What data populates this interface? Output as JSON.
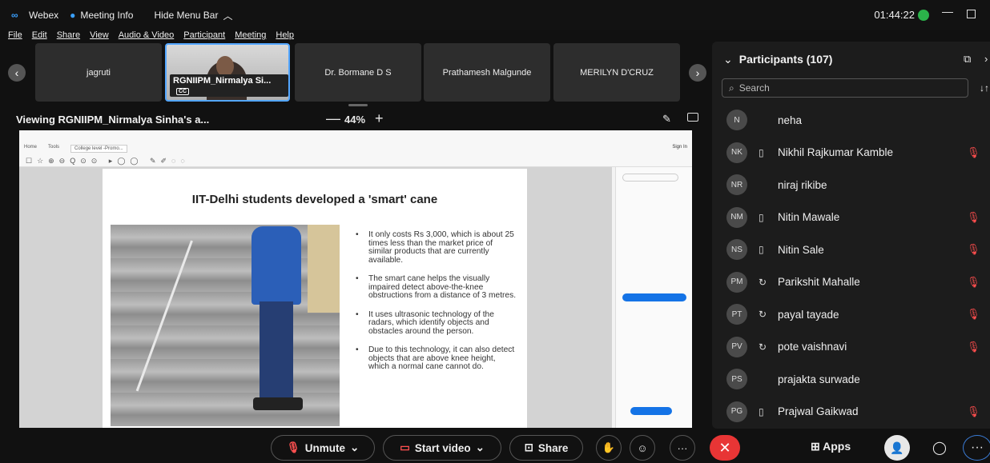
{
  "titlebar": {
    "app": "Webex",
    "meeting_info": "Meeting Info",
    "hide_menu": "Hide Menu Bar",
    "clock": "01:44:22"
  },
  "menu": [
    "File",
    "Edit",
    "Share",
    "View",
    "Audio & Video",
    "Participant",
    "Meeting",
    "Help"
  ],
  "strip": {
    "tiles": [
      "jagruti",
      "Dr. Bormane D S",
      "Prathamesh Malgunde",
      "MERILYN D'CRUZ"
    ],
    "active_name": "RGNIIPM_Nirmalya Si...",
    "cc": "CC"
  },
  "viewing": {
    "title": "Viewing RGNIIPM_Nirmalya Sinha's a...",
    "zoom": "44%"
  },
  "slide": {
    "title": "IIT-Delhi students developed a 'smart' cane",
    "bullets": [
      "It only costs Rs 3,000, which is about 25 times less than the market price of similar products that are currently available.",
      "The smart cane helps the visually impaired detect above-the-knee obstructions from a distance of 3 metres.",
      "It uses ultrasonic technology of the radars, which identify objects and obstacles around the person.",
      "Due to this technology, it can also detect objects that are above knee height, which a normal cane cannot do."
    ]
  },
  "acrobat": {
    "tabs": [
      "Home",
      "Tools",
      "College level -Promo..."
    ],
    "sign_in": "Sign In"
  },
  "panel": {
    "title": "Participants (107)",
    "search_placeholder": "Search",
    "participants": [
      {
        "initials": "N",
        "name": "neha",
        "icon": "",
        "muted": false
      },
      {
        "initials": "NK",
        "name": "Nikhil Rajkumar Kamble",
        "icon": "device-icon",
        "muted": true
      },
      {
        "initials": "NR",
        "name": "niraj rikibe",
        "icon": "",
        "muted": false
      },
      {
        "initials": "NM",
        "name": "Nitin Mawale",
        "icon": "device-icon",
        "muted": true
      },
      {
        "initials": "NS",
        "name": "Nitin Sale",
        "icon": "device-icon",
        "muted": true
      },
      {
        "initials": "PM",
        "name": "Parikshit Mahalle",
        "icon": "sync-icon",
        "muted": true
      },
      {
        "initials": "PT",
        "name": "payal tayade",
        "icon": "sync-icon",
        "muted": true
      },
      {
        "initials": "PV",
        "name": "pote vaishnavi",
        "icon": "sync-icon",
        "muted": true
      },
      {
        "initials": "PS",
        "name": "prajakta surwade",
        "icon": "",
        "muted": false
      },
      {
        "initials": "PG",
        "name": "Prajwal Gaikwad",
        "icon": "device-icon",
        "muted": true
      }
    ]
  },
  "controls": {
    "unmute": "Unmute",
    "start_video": "Start video",
    "share": "Share",
    "apps": "Apps"
  },
  "colors": {
    "accent_blue": "#54a7ff",
    "end_red": "#e83535",
    "mute_red": "#ff4d4d",
    "status_green": "#2bb34a"
  }
}
